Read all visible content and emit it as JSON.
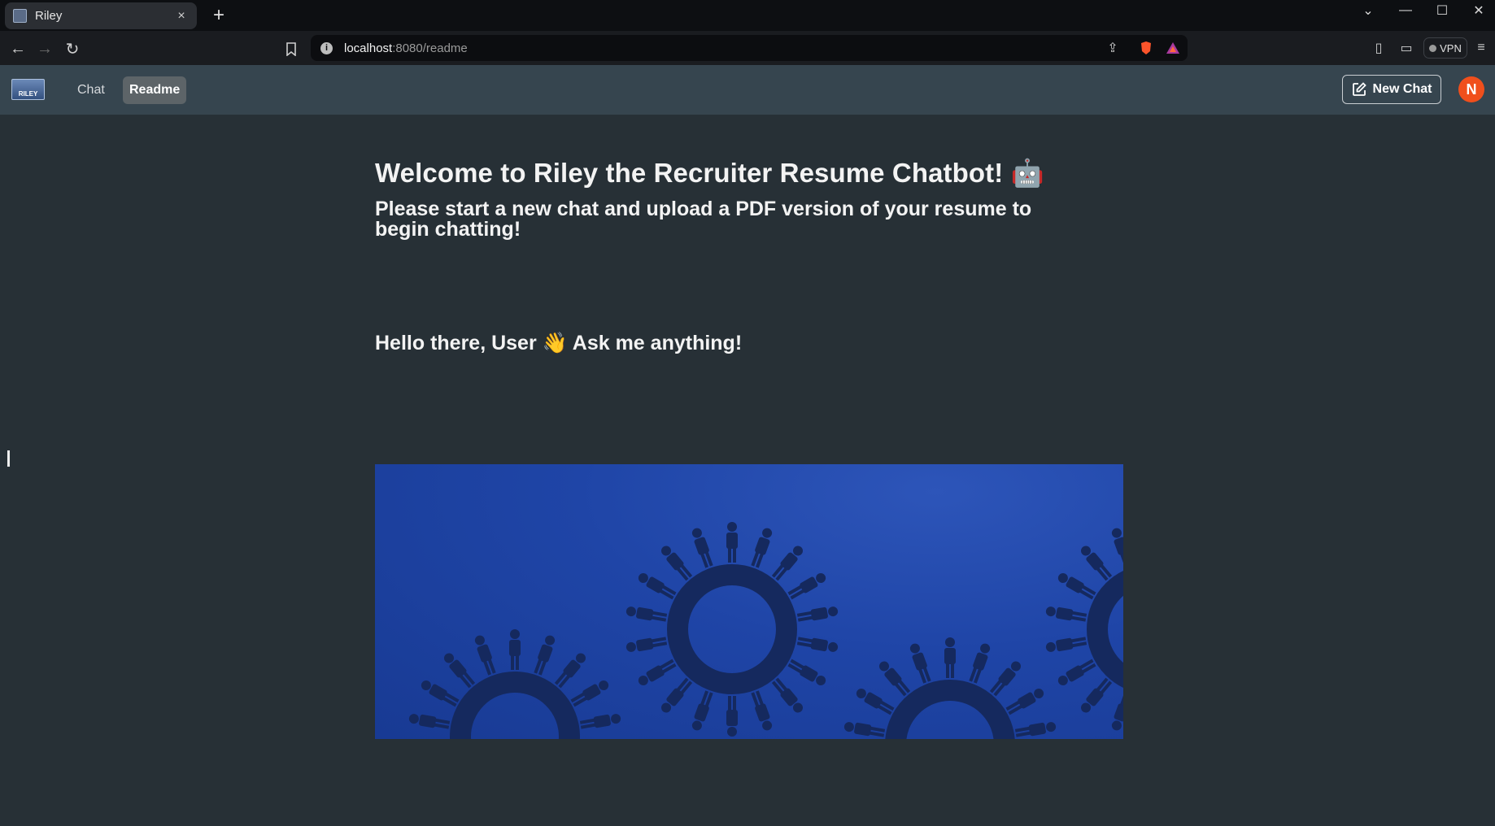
{
  "browser": {
    "tab_title": "Riley",
    "tab_close": "×",
    "new_tab": "+",
    "url_host": "localhost",
    "url_rest": ":8080/readme",
    "vpn_label": "VPN"
  },
  "app": {
    "logo_text": "RILEY",
    "nav": [
      {
        "label": "Chat",
        "active": false
      },
      {
        "label": "Readme",
        "active": true
      }
    ],
    "new_chat_label": "New Chat",
    "avatar_initial": "N"
  },
  "content": {
    "title": "Welcome to Riley the Recruiter Resume Chatbot! 🤖",
    "subtitle": "Please start a new chat and upload a PDF version of your resume to begin chatting!",
    "greeting": "Hello there, User 👋 Ask me anything!"
  },
  "colors": {
    "background": "#273036",
    "header": "#36454f",
    "avatar": "#f04f1c",
    "banner": "#1f45a7"
  }
}
